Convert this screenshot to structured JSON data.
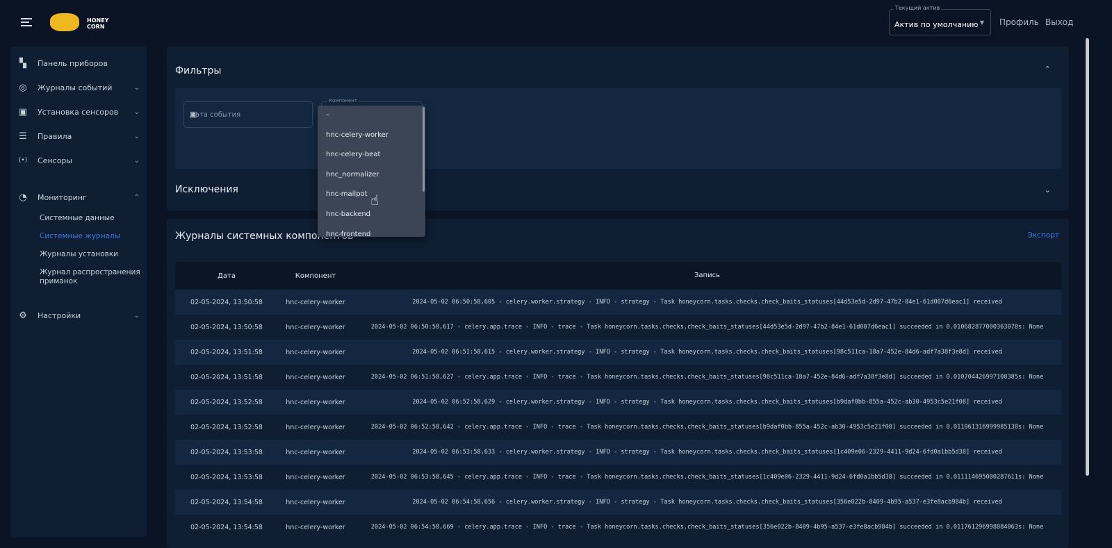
{
  "header": {
    "brand": "HONEY CORN",
    "brand_line1": "HONEY",
    "brand_line2": "CORN",
    "asset_label": "Текущий актив",
    "asset_value": "Актив по умолчанию",
    "profile": "Профиль",
    "logout": "Выход"
  },
  "sidebar": {
    "items": [
      {
        "label": "Панель приборов",
        "icon": "dashboard-icon"
      },
      {
        "label": "Журналы событий",
        "icon": "radar-icon"
      },
      {
        "label": "Установка сенсоров",
        "icon": "toolbox-icon"
      },
      {
        "label": "Правила",
        "icon": "list-icon"
      },
      {
        "label": "Сенсоры",
        "icon": "broadcast-icon"
      },
      {
        "label": "Мониторинг",
        "icon": "gauge-icon"
      },
      {
        "label": "Настройки",
        "icon": "gear-icon"
      }
    ],
    "sub": [
      "Системные данные",
      "Системные журналы",
      "Журналы установки",
      "Журнал распространения приманок"
    ],
    "active_sub": "Системные журналы"
  },
  "filters": {
    "title": "Фильтры",
    "date_placeholder": "Дата события",
    "component_label": "Компонент",
    "options": [
      "–",
      "hnc-celery-worker",
      "hnc-celery-beat",
      "hnc_normalizer",
      "hnc-mailpot",
      "hnc-backend",
      "hnc-frontend"
    ],
    "hovered": "hnc-mailpot"
  },
  "exclusions": {
    "title": "Исключения"
  },
  "logs": {
    "title": "Журналы системных компонентов",
    "export": "Экспорт",
    "columns": [
      "Дата",
      "Компонент",
      "Запись"
    ],
    "rows": [
      [
        "02-05-2024, 13:50:58",
        "hnc-celery-worker",
        "2024-05-02 06:50:58,605 - celery.worker.strategy - INFO - strategy - Task honeycorn.tasks.checks.check_baits_statuses[44d53e5d-2d97-47b2-84e1-61d007d6eac1] received"
      ],
      [
        "02-05-2024, 13:50:58",
        "hnc-celery-worker",
        "2024-05-02 06:50:58,617 - celery.app.trace - INFO - trace - Task honeycorn.tasks.checks.check_baits_statuses[44d53e5d-2d97-47b2-84e1-61d007d6eac1] succeeded in 0.010682877000363078s: None"
      ],
      [
        "02-05-2024, 13:51:58",
        "hnc-celery-worker",
        "2024-05-02 06:51:58,615 - celery.worker.strategy - INFO - strategy - Task honeycorn.tasks.checks.check_baits_statuses[98c511ca-18a7-452e-84d6-adf7a38f3e8d] received"
      ],
      [
        "02-05-2024, 13:51:58",
        "hnc-celery-worker",
        "2024-05-02 06:51:58,627 - celery.app.trace - INFO - trace - Task honeycorn.tasks.checks.check_baits_statuses[98c511ca-18a7-452e-84d6-adf7a38f3e8d] succeeded in 0.010704426997108385s: None"
      ],
      [
        "02-05-2024, 13:52:58",
        "hnc-celery-worker",
        "2024-05-02 06:52:58,629 - celery.worker.strategy - INFO - strategy - Task honeycorn.tasks.checks.check_baits_statuses[b9daf0bb-855a-452c-ab30-4953c5e21f08] received"
      ],
      [
        "02-05-2024, 13:52:58",
        "hnc-celery-worker",
        "2024-05-02 06:52:58,642 - celery.app.trace - INFO - trace - Task honeycorn.tasks.checks.check_baits_statuses[b9daf0bb-855a-452c-ab30-4953c5e21f08] succeeded in 0.011061316999985138s: None"
      ],
      [
        "02-05-2024, 13:53:58",
        "hnc-celery-worker",
        "2024-05-02 06:53:58,633 - celery.worker.strategy - INFO - strategy - Task honeycorn.tasks.checks.check_baits_statuses[1c409e06-2329-4411-9d24-6fd0a1bb5d38] received"
      ],
      [
        "02-05-2024, 13:53:58",
        "hnc-celery-worker",
        "2024-05-02 06:53:58,645 - celery.app.trace - INFO - trace - Task honeycorn.tasks.checks.check_baits_statuses[1c409e06-2329-4411-9d24-6fd0a1bb5d38] succeeded in 0.011114695000287611s: None"
      ],
      [
        "02-05-2024, 13:54:58",
        "hnc-celery-worker",
        "2024-05-02 06:54:58,656 - celery.worker.strategy - INFO - strategy - Task honeycorn.tasks.checks.check_baits_statuses[356e022b-8409-4b95-a537-e3fe8acb984b] received"
      ],
      [
        "02-05-2024, 13:54:58",
        "hnc-celery-worker",
        "2024-05-02 06:54:58,669 - celery.app.trace - INFO - trace - Task honeycorn.tasks.checks.check_baits_statuses[356e022b-8409-4b95-a537-e3fe8acb984b] succeeded in 0.011761296998884063s: None"
      ]
    ]
  },
  "colors": {
    "accent": "#3a7be0",
    "logo": "#f0b820",
    "background": "#0a1424",
    "panel": "#0f1e33"
  }
}
